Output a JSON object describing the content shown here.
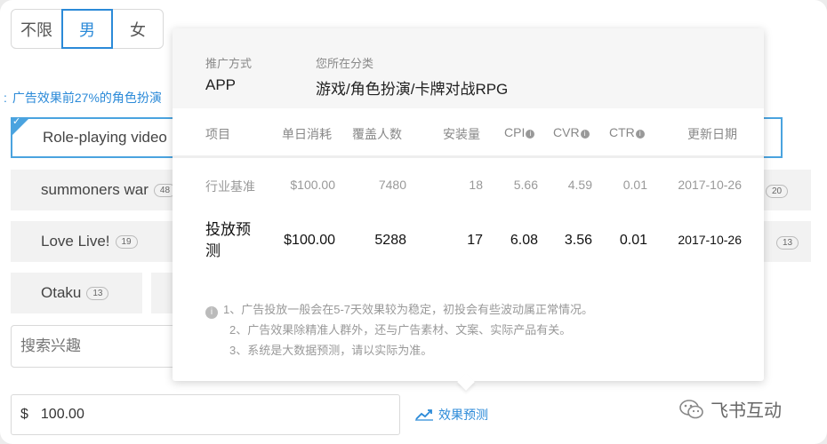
{
  "gender": {
    "options": [
      "不限",
      "男",
      "女"
    ],
    "selected": "男"
  },
  "hint": "广告效果前27%的角色扮演",
  "interests": [
    {
      "label": "Role-playing video",
      "badge": "",
      "selected": true
    },
    {
      "label": "summoners war",
      "badge": "48"
    },
    {
      "label": "Love Live!",
      "badge": "19"
    },
    {
      "label": "Otaku",
      "badge": "13"
    }
  ],
  "right_badges": [
    "20",
    "13"
  ],
  "search": {
    "placeholder": "搜索兴趣"
  },
  "budget": {
    "currency": "$",
    "value": "100.00"
  },
  "predict_link": "效果预测",
  "watermark": "飞书互动",
  "popup": {
    "promo_label": "推广方式",
    "promo_value": "APP",
    "category_label": "您所在分类",
    "category_value": "游戏/角色扮演/卡牌对战RPG",
    "headers": [
      "项目",
      "单日消耗",
      "覆盖人数",
      "安装量",
      "CPI",
      "CVR",
      "CTR",
      "更新日期"
    ],
    "info_marks": [
      "i",
      "i",
      "i"
    ],
    "rows": [
      [
        "行业基准",
        "$100.00",
        "7480",
        "18",
        "5.66",
        "4.59",
        "0.01",
        "2017-10-26"
      ],
      [
        "投放预测",
        "$100.00",
        "5288",
        "17",
        "6.08",
        "3.56",
        "0.01",
        "2017-10-26"
      ]
    ],
    "note_icon": "i",
    "notes": [
      "1、广告投放一般会在5-7天效果较为稳定，初投会有些波动属正常情况。",
      "2、广告效果除精准人群外，还与广告素材、文案、实际产品有关。",
      "3、系统是大数据预测，请以实际为准。"
    ]
  },
  "colors": {
    "accent": "#2b8ad8",
    "selected_border": "#4aa3df"
  }
}
